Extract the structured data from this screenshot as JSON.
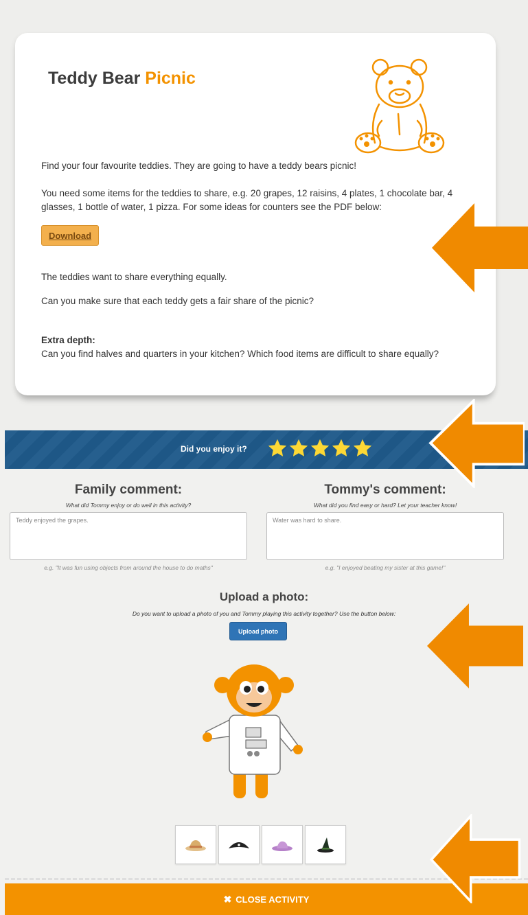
{
  "activity": {
    "title_main": "Teddy Bear",
    "title_accent": "Picnic",
    "paragraph_1": "Find your four favourite teddies. They are going to have a teddy bears picnic!",
    "paragraph_2": "You need some items for the teddies to share, e.g. 20 grapes, 12 raisins, 4 plates, 1 chocolate bar, 4 glasses, 1 bottle of water, 1 pizza. For some ideas for counters see the PDF below:",
    "download_label": "Download",
    "paragraph_3": "The teddies want to share everything equally.",
    "paragraph_4": "Can you make sure that each teddy gets a fair share of the picnic?",
    "extra_depth_label": "Extra depth:",
    "extra_depth_text": "Can you find halves and quarters in your kitchen? Which food items are difficult to share equally?"
  },
  "rating": {
    "question": "Did you enjoy it?",
    "stars": 5,
    "max_stars": 5,
    "star_color": "#fdd835"
  },
  "family_comment": {
    "title": "Family comment:",
    "prompt": "What did Tommy enjoy or do well in this activity?",
    "value": "Teddy enjoyed the grapes.",
    "example": "e.g. \"It was fun using objects from around the house to do maths\""
  },
  "child_comment": {
    "title": "Tommy's comment:",
    "prompt": "What did you find easy or hard? Let your teacher know!",
    "value": "Water was hard to share.",
    "example": "e.g. \"I enjoyed beating my sister at this game!\""
  },
  "upload": {
    "title": "Upload a photo:",
    "prompt": "Do you want to upload a photo of you and Tommy playing this activity together? Use the button below:",
    "button_label": "Upload photo"
  },
  "outfits": [
    {
      "icon": "sun-hat-icon"
    },
    {
      "icon": "pirate-hat-icon"
    },
    {
      "icon": "purple-hat-icon"
    },
    {
      "icon": "witch-hat-icon"
    }
  ],
  "close_label": "CLOSE ACTIVITY",
  "colors": {
    "accent": "#f39200",
    "banner": "#1f5a8a",
    "button_blue": "#2f74b6",
    "download_button": "#f3b04d"
  }
}
